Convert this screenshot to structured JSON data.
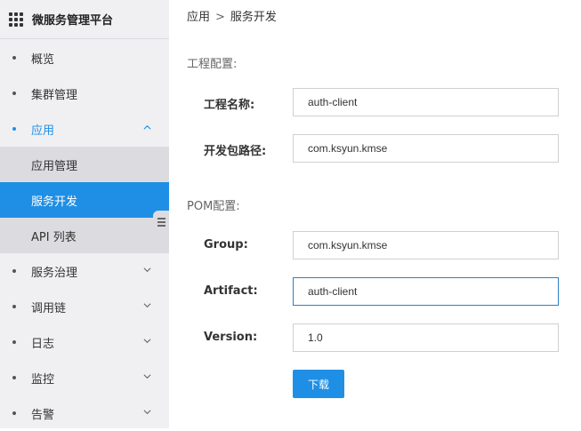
{
  "sidebar": {
    "brand_title": "微服务管理平台",
    "items": [
      {
        "label": "概览"
      },
      {
        "label": "集群管理"
      },
      {
        "label": "应用"
      },
      {
        "label": "服务治理"
      },
      {
        "label": "调用链"
      },
      {
        "label": "日志"
      },
      {
        "label": "监控"
      },
      {
        "label": "告警"
      }
    ],
    "subitems": [
      {
        "label": "应用管理"
      },
      {
        "label": "服务开发"
      },
      {
        "label": "API 列表"
      }
    ],
    "accent_color": "#1f8fe5"
  },
  "breadcrumb": {
    "parent": "应用",
    "separator": ">",
    "current": "服务开发"
  },
  "project_config": {
    "title": "工程配置:",
    "name_label": "工程名称:",
    "name_value": "auth-client",
    "package_label": "开发包路径:",
    "package_value": "com.ksyun.kmse"
  },
  "pom_config": {
    "title": "POM配置:",
    "group_label": "Group:",
    "group_value": "com.ksyun.kmse",
    "artifact_label": "Artifact:",
    "artifact_value": "auth-client",
    "version_label": "Version:",
    "version_value": "1.0"
  },
  "download_label": "下载"
}
